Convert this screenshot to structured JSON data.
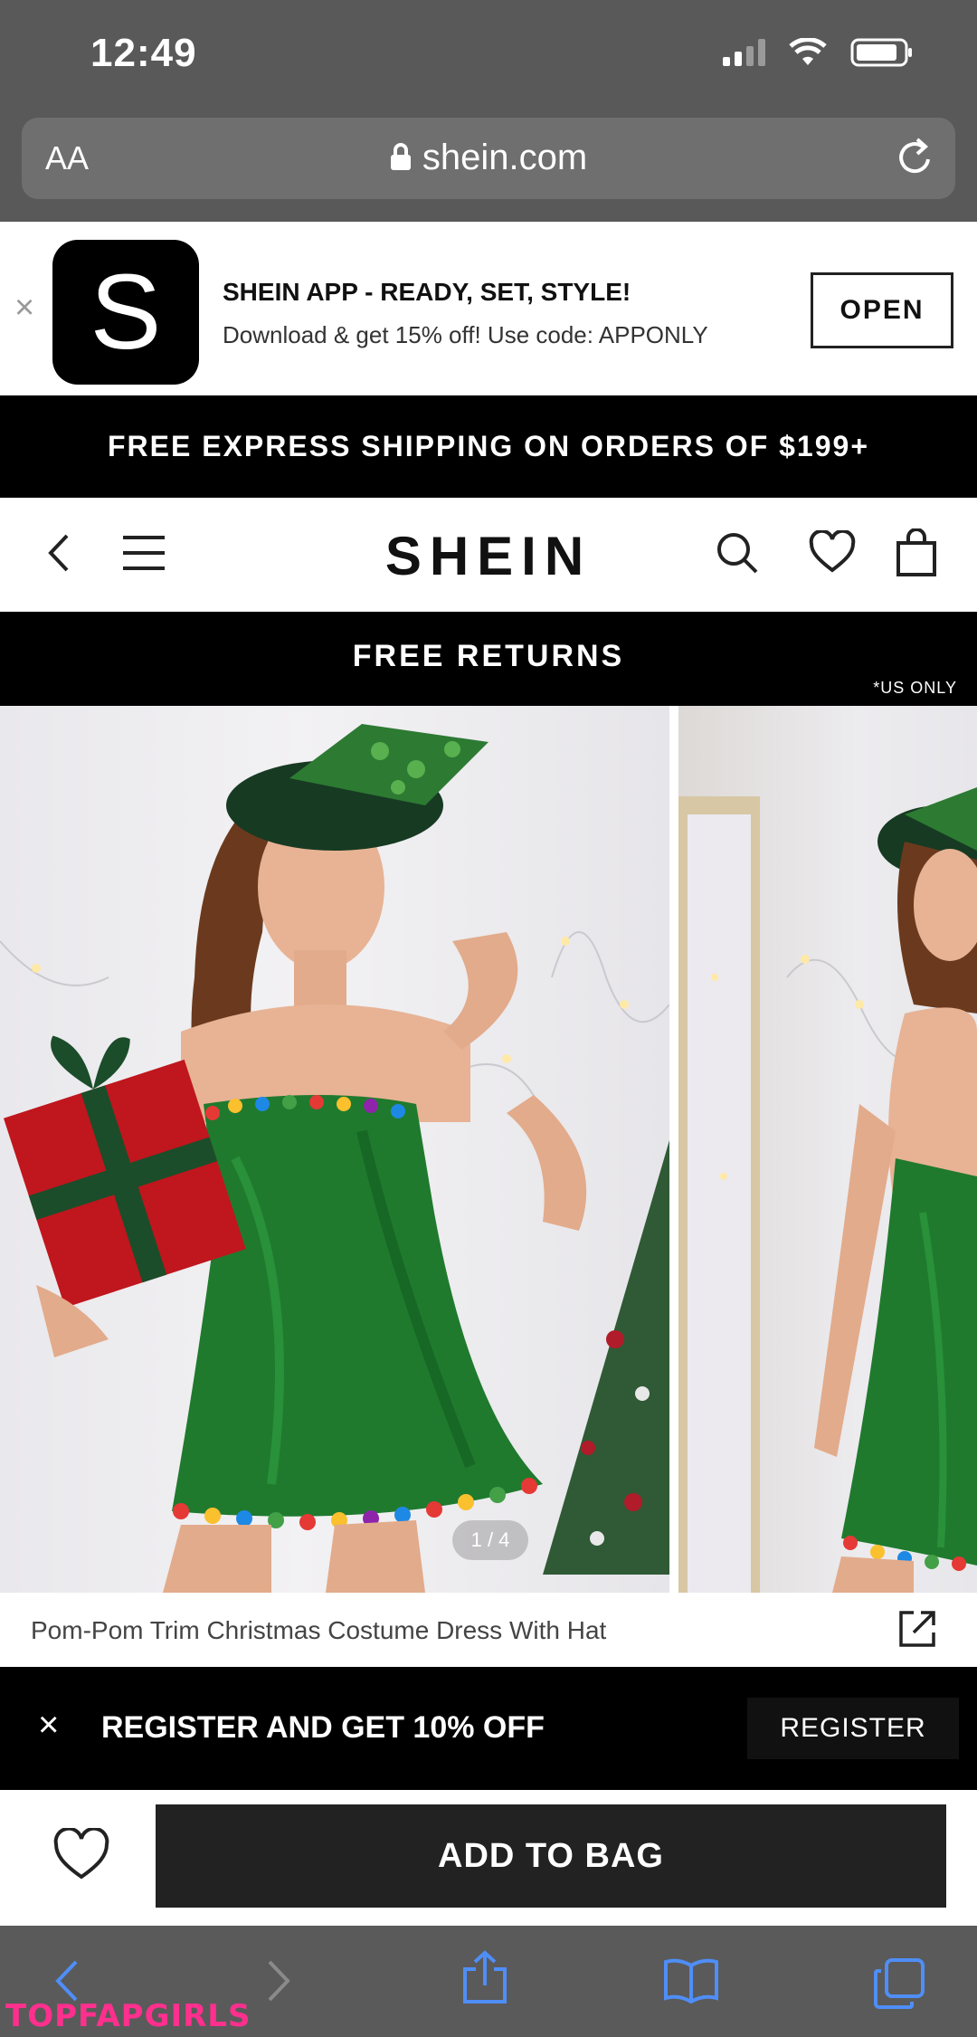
{
  "status_bar": {
    "time": "12:49"
  },
  "browser": {
    "aa_label": "AA",
    "url": "shein.com"
  },
  "app_banner": {
    "close": "×",
    "logo_letter": "S",
    "title": "SHEIN APP - READY, SET, STYLE!",
    "subtitle": "Download & get 15% off! Use code: APPONLY",
    "open_label": "OPEN"
  },
  "shipping_banner": "FREE EXPRESS SHIPPING ON ORDERS OF $199+",
  "nav": {
    "logo": "SHEIN"
  },
  "returns_banner": {
    "text": "FREE RETURNS",
    "note": "*US ONLY"
  },
  "gallery": {
    "pager": "1 / 4"
  },
  "product": {
    "title": "Pom-Pom Trim Christmas Costume Dress With Hat"
  },
  "register_bar": {
    "close": "×",
    "text": "REGISTER AND GET 10% OFF",
    "button": "REGISTER"
  },
  "actions": {
    "add_to_bag": "ADD TO BAG"
  },
  "watermark": "TOPFAPGIRLS",
  "colors": {
    "accent": "#000000",
    "chrome": "#595959",
    "dress_green": "#1f7a2e",
    "watermark": "#ff2f8e"
  }
}
